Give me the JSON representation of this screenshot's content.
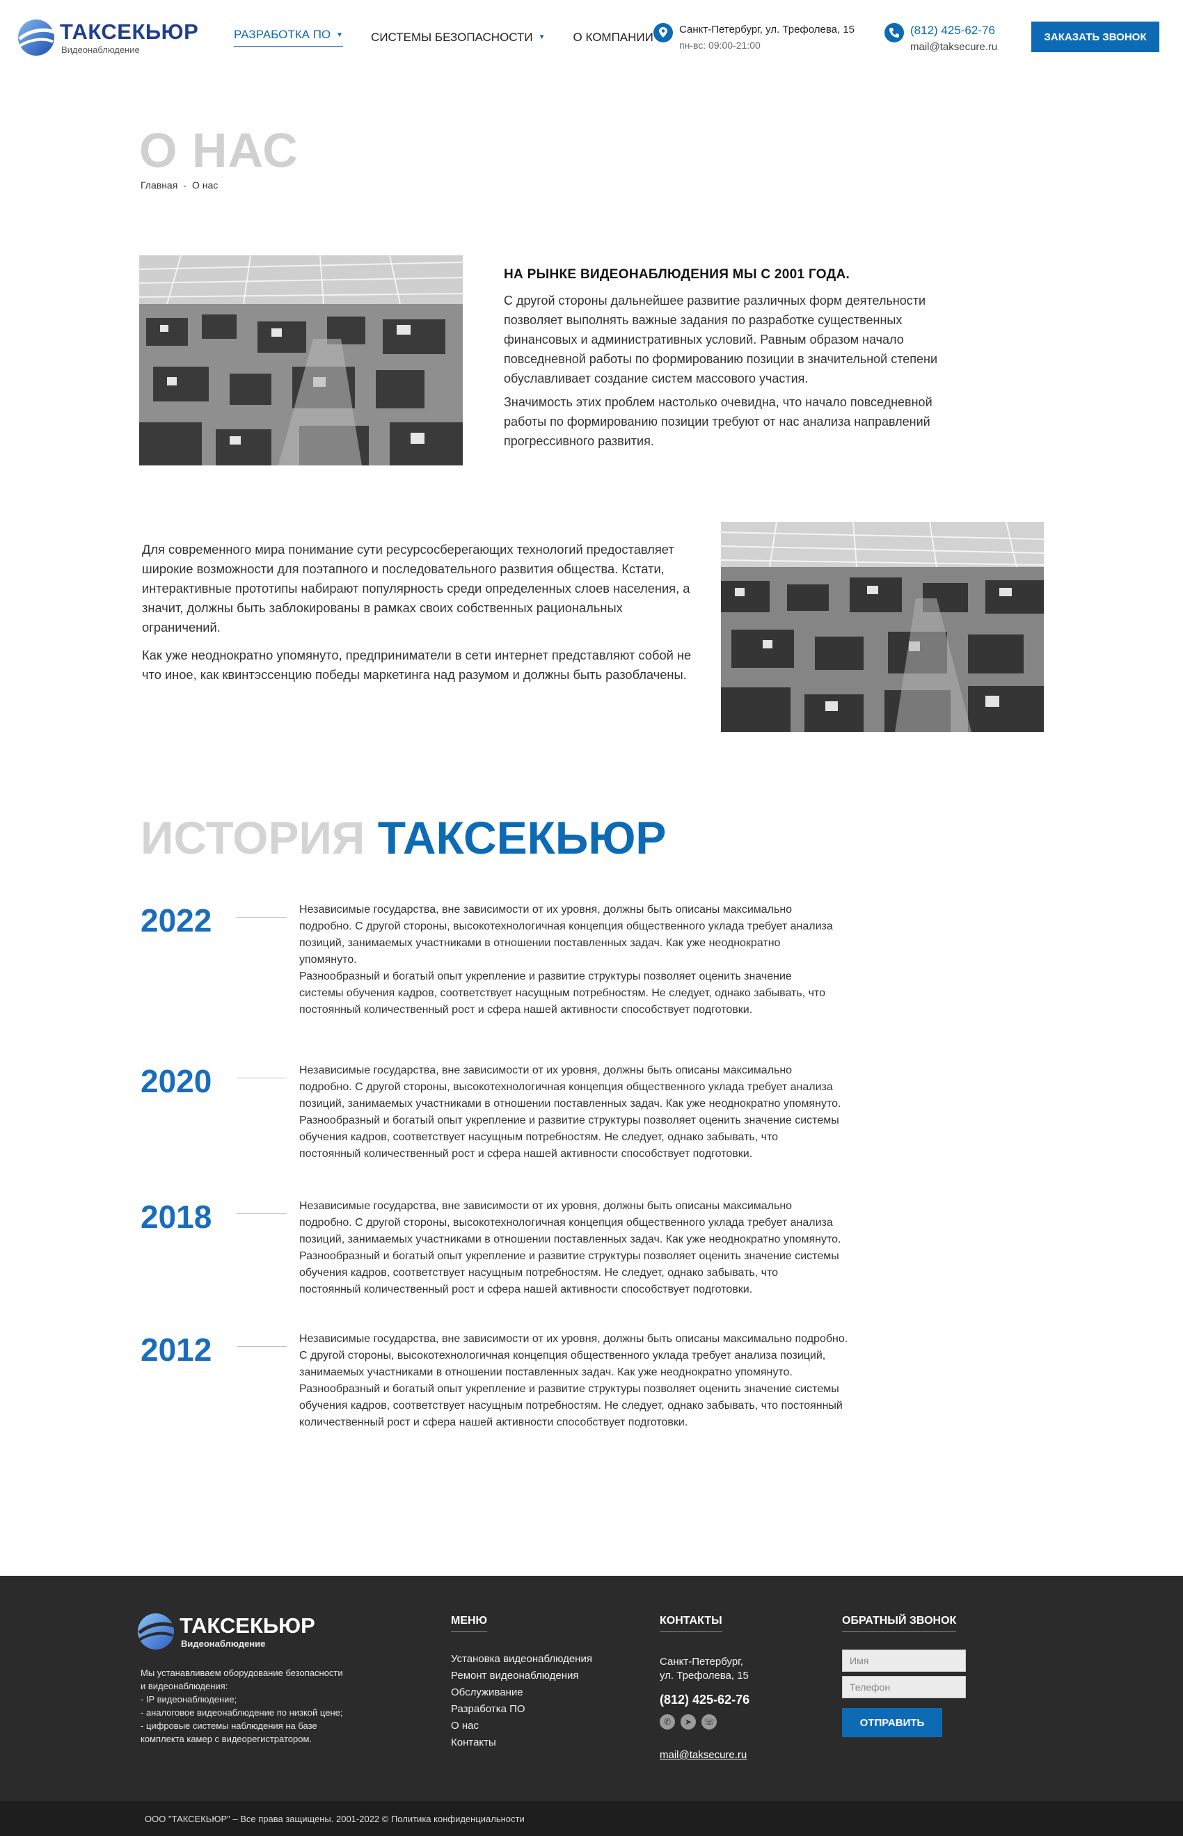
{
  "header": {
    "logo_title": "ТАКСЕКЬЮР",
    "logo_subtitle": "Видеонаблюдение",
    "nav": [
      {
        "label": "РАЗРАБОТКА ПО"
      },
      {
        "label": "СИСТЕМЫ БЕЗОПАСНОСТИ"
      },
      {
        "label": "О КОМПАНИИ"
      }
    ],
    "address": "Санкт-Петербург, ул. Трефолева, 15",
    "hours": "пн-вс: 09:00-21:00",
    "phone": "(812) 425-62-76",
    "email": "mail@taksecure.ru",
    "cta_label": "ЗАКАЗАТЬ ЗВОНОК"
  },
  "page": {
    "title": "О НАС",
    "breadcrumb": {
      "home": "Главная",
      "separator": "-",
      "current": "О нас"
    }
  },
  "about": {
    "heading": "НА РЫНКЕ ВИДЕОНАБЛЮДЕНИЯ МЫ С 2001 ГОДА.",
    "p1": "С другой стороны дальнейшее развитие различных форм деятельности позволяет выполнять важные задания по разработке существенных финансовых и административных условий. Равным образом начало повседневной работы по формированию позиции в значительной степени обуславливает создание систем массового участия.",
    "p2": "Значимость этих проблем настолько очевидна, что начало повседневной работы по формированию позиции требуют от нас анализа направлений прогрессивного развития.",
    "p3": "Для современного мира понимание сути ресурсосберегающих технологий предоставляет широкие возможности для поэтапного и последовательного развития общества. Кстати, интерактивные прототипы набирают популярность среди определенных слоев населения, а значит, должны быть заблокированы в рамках своих собственных рациональных ограничений.",
    "p4": "Как уже неоднократно упомянуто, предприниматели в сети интернет представляют собой не что иное, как квинтэссенцию победы маркетинга над разумом и должны быть разоблачены."
  },
  "history": {
    "title_grey": "ИСТОРИЯ",
    "title_blue": "ТАКСЕКЬЮР",
    "items": [
      {
        "year": "2022",
        "lines": [
          "Независимые государства, вне зависимости от их уровня, должны быть описаны максимально",
          "подробно. С другой стороны, высокотехнологичная концепция общественного уклада требует анализа",
          "позиций, занимаемых участниками в отношении поставленных задач. Как уже неоднократно",
          "упомянуто.",
          "Разнообразный и богатый опыт укрепление и развитие структуры позволяет оценить значение",
          "системы обучения кадров, соответствует насущным потребностям. Не следует, однако забывать, что",
          "постоянный количественный рост и сфера нашей активности способствует подготовки."
        ]
      },
      {
        "year": "2020",
        "lines": [
          "Независимые государства, вне зависимости от их уровня, должны быть описаны максимально",
          "подробно. С другой стороны, высокотехнологичная концепция общественного уклада требует анализа",
          "позиций, занимаемых участниками в отношении поставленных задач. Как уже неоднократно упомянуто.",
          "Разнообразный и богатый опыт укрепление и развитие структуры позволяет оценить значение системы",
          "обучения кадров, соответствует насущным потребностям. Не следует, однако забывать, что",
          "постоянный количественный рост и сфера нашей активности способствует подготовки."
        ]
      },
      {
        "year": "2018",
        "lines": [
          "Независимые государства, вне зависимости от их уровня, должны быть описаны максимально",
          "подробно. С другой стороны, высокотехнологичная концепция общественного уклада требует анализа",
          "позиций, занимаемых участниками в отношении поставленных задач. Как уже неоднократно упомянуто.",
          "Разнообразный и богатый опыт укрепление и развитие структуры позволяет оценить значение системы",
          "обучения кадров, соответствует насущным потребностям. Не следует, однако забывать, что",
          "постоянный количественный рост и сфера нашей активности способствует подготовки."
        ]
      },
      {
        "year": "2012",
        "lines": [
          "Независимые государства, вне зависимости от их уровня, должны быть описаны максимально подробно.",
          "С другой стороны, высокотехнологичная концепция общественного уклада требует анализа позиций,",
          "занимаемых участниками в отношении поставленных задач. Как уже неоднократно упомянуто.",
          "Разнообразный и богатый опыт укрепление и развитие структуры позволяет оценить значение системы",
          "обучения кадров, соответствует насущным потребностям. Не следует, однако забывать, что постоянный",
          "количественный рост и сфера нашей активности способствует подготовки."
        ]
      }
    ]
  },
  "footer": {
    "logo_title": "ТАКСЕКЬЮР",
    "logo_subtitle": "Видеонаблюдение",
    "description_lines": [
      "Мы устанавливаем оборудование безопасности",
      "и видеонаблюдения:",
      "- IP видеонаблюдение;",
      "- аналоговое видеонаблюдение по низкой цене;",
      "- цифровые системы наблюдения на базе",
      "комплекта камер с видеорегистратором."
    ],
    "menu_title": "МЕНЮ",
    "menu": [
      "Установка видеонаблюдения",
      "Ремонт видеонаблюдения",
      "Обслуживание",
      "Разработка ПО",
      "О нас",
      "Контакты"
    ],
    "contacts_title": "КОНТАКТЫ",
    "address_line1": "Санкт-Петербург,",
    "address_line2": "ул. Трефолева, 15",
    "phone": "(812) 425-62-76",
    "email": "mail@taksecure.ru",
    "socials": [
      "whatsapp-icon",
      "telegram-icon",
      "viber-icon"
    ],
    "callback_title": "ОБРАТНЫЙ ЗВОНОК",
    "name_placeholder": "Имя",
    "phone_placeholder": "Телефон",
    "send_label": "ОТПРАВИТЬ",
    "copyright": "ООО \"ТАКСЕКЬЮР\" – Все права защищены.  2001-2022 © Политика конфиденциальности"
  },
  "colors": {
    "brand_blue": "#0d6ab5",
    "dark_footer": "#2b2b2b",
    "title_grey": "#d0d0d0"
  }
}
